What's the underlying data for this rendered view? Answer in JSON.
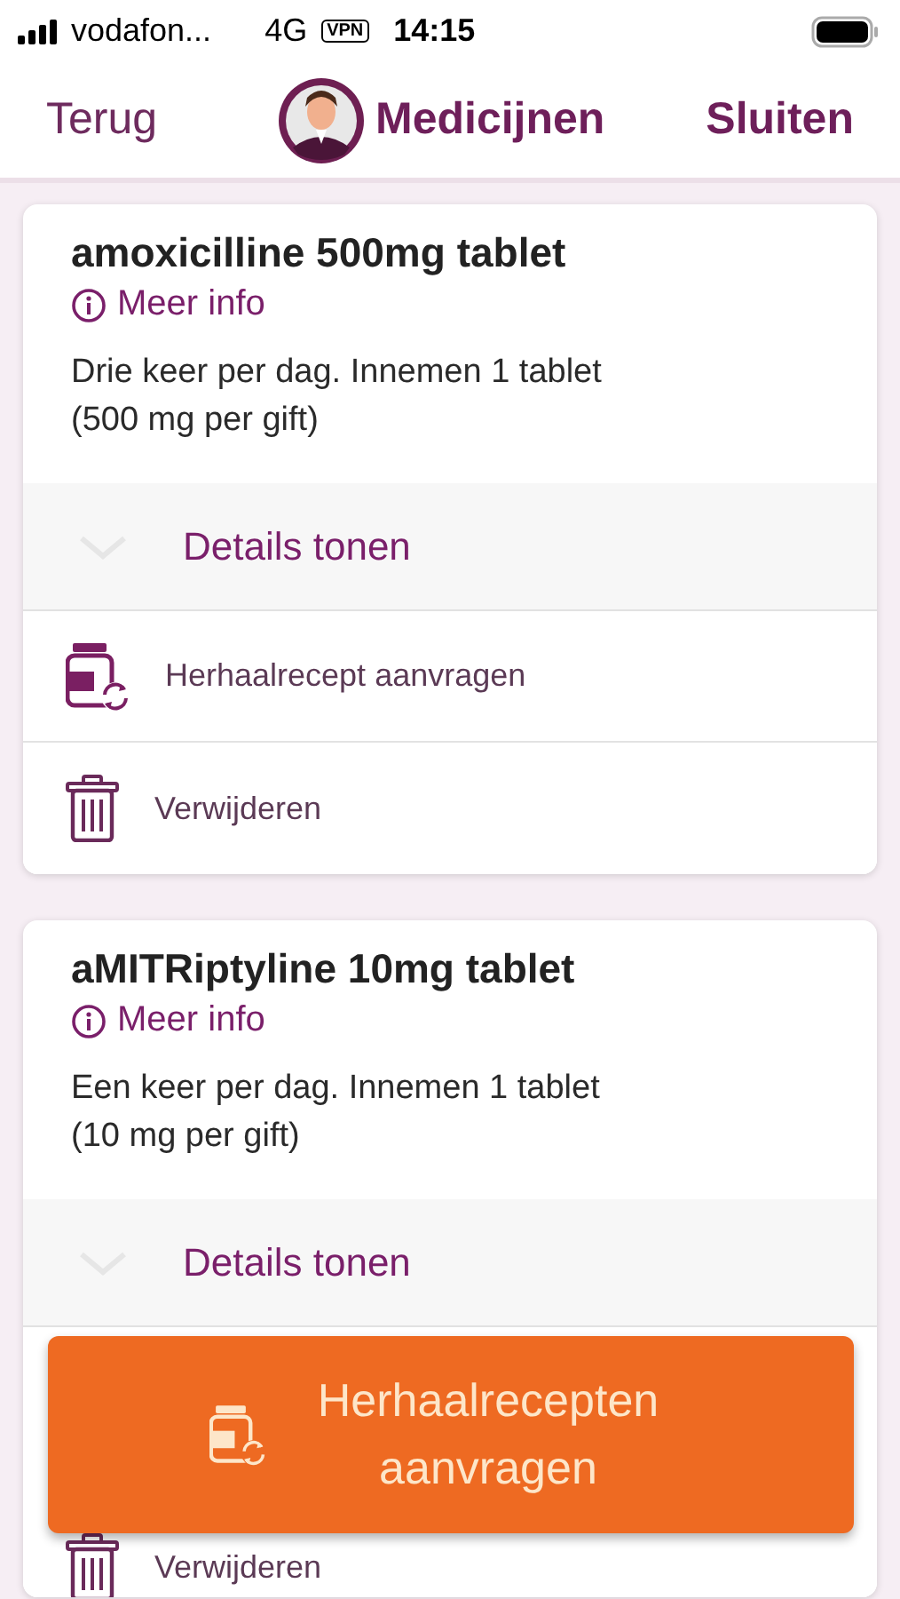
{
  "status_bar": {
    "carrier": "vodafon...",
    "network": "4G",
    "vpn": "VPN",
    "time": "14:15"
  },
  "nav": {
    "back": "Terug",
    "title": "Medicijnen",
    "close": "Sluiten"
  },
  "medications": [
    {
      "name": "amoxicilline 500mg tablet",
      "info_link": "Meer info",
      "dosage": "Drie keer per dag. Innemen 1 tablet (500 mg per gift)",
      "details": "Details tonen",
      "actions": [
        {
          "kind": "refill",
          "label": "Herhaalrecept aanvragen"
        },
        {
          "kind": "delete",
          "label": "Verwijderen"
        }
      ]
    },
    {
      "name": "aMITRiptyline 10mg tablet",
      "info_link": "Meer info",
      "dosage": "Een keer per dag. Innemen 1 tablet (10 mg per gift)",
      "details": "Details tonen",
      "actions": [
        {
          "kind": "delete",
          "label": "Verwijderen"
        }
      ]
    }
  ],
  "floating_button": {
    "label": "Herhaalrecepten aanvragen"
  }
}
